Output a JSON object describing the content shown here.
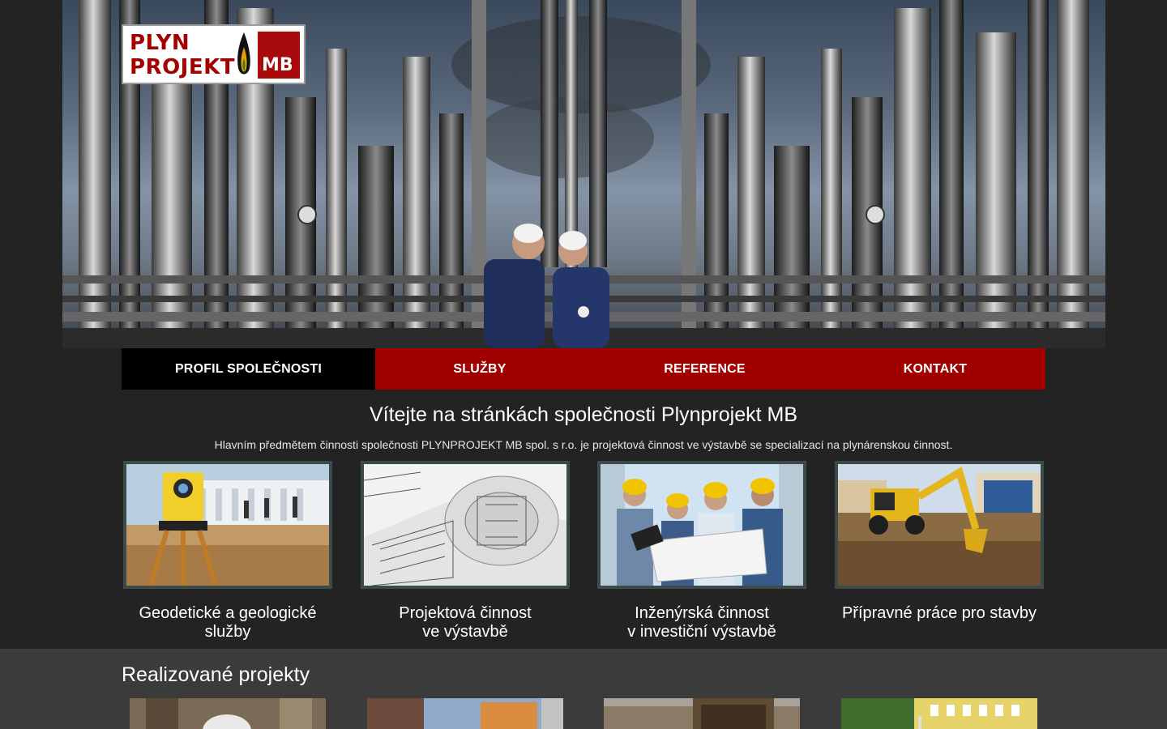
{
  "logo": {
    "line1": "PLYN",
    "line2": "PROJEKT",
    "badge": "MB"
  },
  "nav": {
    "items": [
      {
        "label": "PROFIL SPOLEČNOSTI",
        "active": true
      },
      {
        "label": "SLUŽBY"
      },
      {
        "label": "REFERENCE"
      },
      {
        "label": "KONTAKT"
      }
    ]
  },
  "welcome": {
    "title": "Vítejte na stránkách společnosti Plynprojekt MB",
    "text": "Hlavním předmětem činnosti společnosti PLYNPROJEKT MB spol. s r.o. je projektová činnost ve výstavbě se specializací na plynárenskou činnost."
  },
  "services": [
    {
      "line1": "Geodetické a geologické",
      "line2": "služby"
    },
    {
      "line1": "Projektová činnost",
      "line2": "ve výstavbě"
    },
    {
      "line1": "Inženýrská činnost",
      "line2": "v investiční výstavbě"
    },
    {
      "line1": "Přípravné práce pro stavby",
      "line2": ""
    }
  ],
  "projects": {
    "title": "Realizované projekty"
  },
  "colors": {
    "brand_red": "#a00000",
    "background": "#232323",
    "active_nav": "#000000"
  }
}
